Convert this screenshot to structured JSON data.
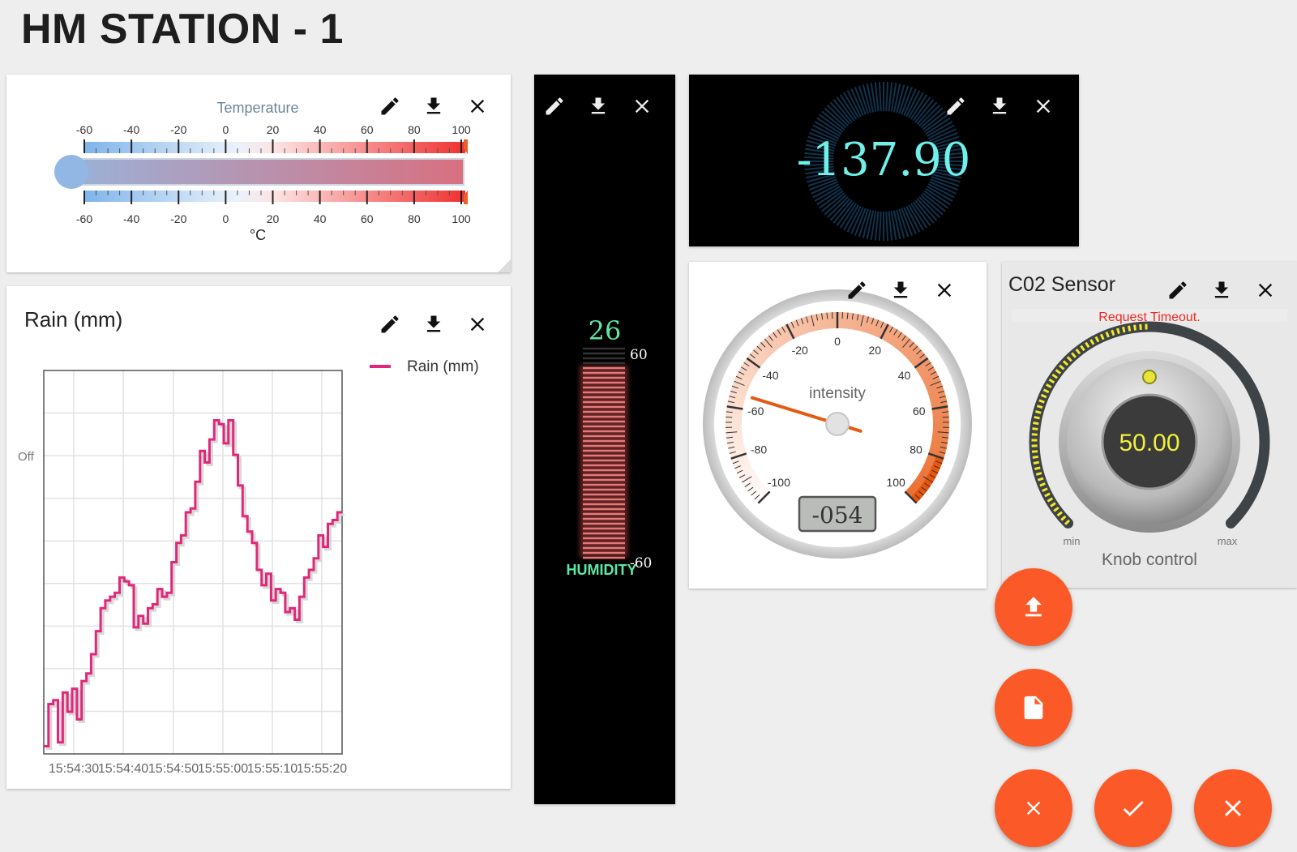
{
  "page": {
    "title": "HM STATION - 1"
  },
  "temperature": {
    "title": "Temperature",
    "unit": "°C",
    "ticks": [
      "-60",
      "-40",
      "-20",
      "0",
      "20",
      "40",
      "60",
      "80",
      "100"
    ],
    "min": -60,
    "max": 100,
    "value": 100
  },
  "rain": {
    "title": "Rain (mm)",
    "legend": "Rain (mm)",
    "y_label": "Off",
    "series_color": "#e0287a",
    "chart_data": {
      "type": "line",
      "x": [
        "15:54:30",
        "15:54:40",
        "15:54:50",
        "15:55:00",
        "15:55:10",
        "15:55:20"
      ],
      "series": [
        {
          "name": "Rain (mm)",
          "values": [
            2,
            13,
            14,
            3,
            16,
            11,
            17,
            9,
            19,
            21,
            26,
            32,
            38,
            40,
            41,
            42,
            46,
            45,
            44,
            33,
            36,
            34,
            38,
            39,
            43,
            41,
            42,
            50,
            55,
            57,
            63,
            64,
            71,
            79,
            76,
            82,
            87,
            86,
            81,
            87,
            78,
            70,
            62,
            58,
            55,
            48,
            44,
            47,
            40,
            43,
            42,
            37,
            38,
            35,
            41,
            46,
            48,
            51,
            57,
            54,
            60,
            61,
            63
          ]
        }
      ],
      "ylim": [
        0,
        100
      ]
    }
  },
  "humidity": {
    "label": "HUMIDITY",
    "value": "26",
    "max_label": "60",
    "min_label": "-60",
    "level": 0.92
  },
  "digital": {
    "value": "-137.90"
  },
  "intensity": {
    "label": "intensity",
    "value_display": "-054",
    "value": -54,
    "ticks": [
      "-100",
      "-80",
      "-60",
      "-40",
      "-20",
      "0",
      "20",
      "40",
      "60",
      "80",
      "100"
    ]
  },
  "co2": {
    "title": "C02 Sensor",
    "error": "Request Timeout.",
    "value": "50.00",
    "min_label": "min",
    "max_label": "max",
    "caption": "Knob control",
    "level": 0.5
  },
  "colors": {
    "accent": "#fb5a28",
    "digital": "#6ff0e8",
    "humidity_text": "#5de8a4"
  }
}
